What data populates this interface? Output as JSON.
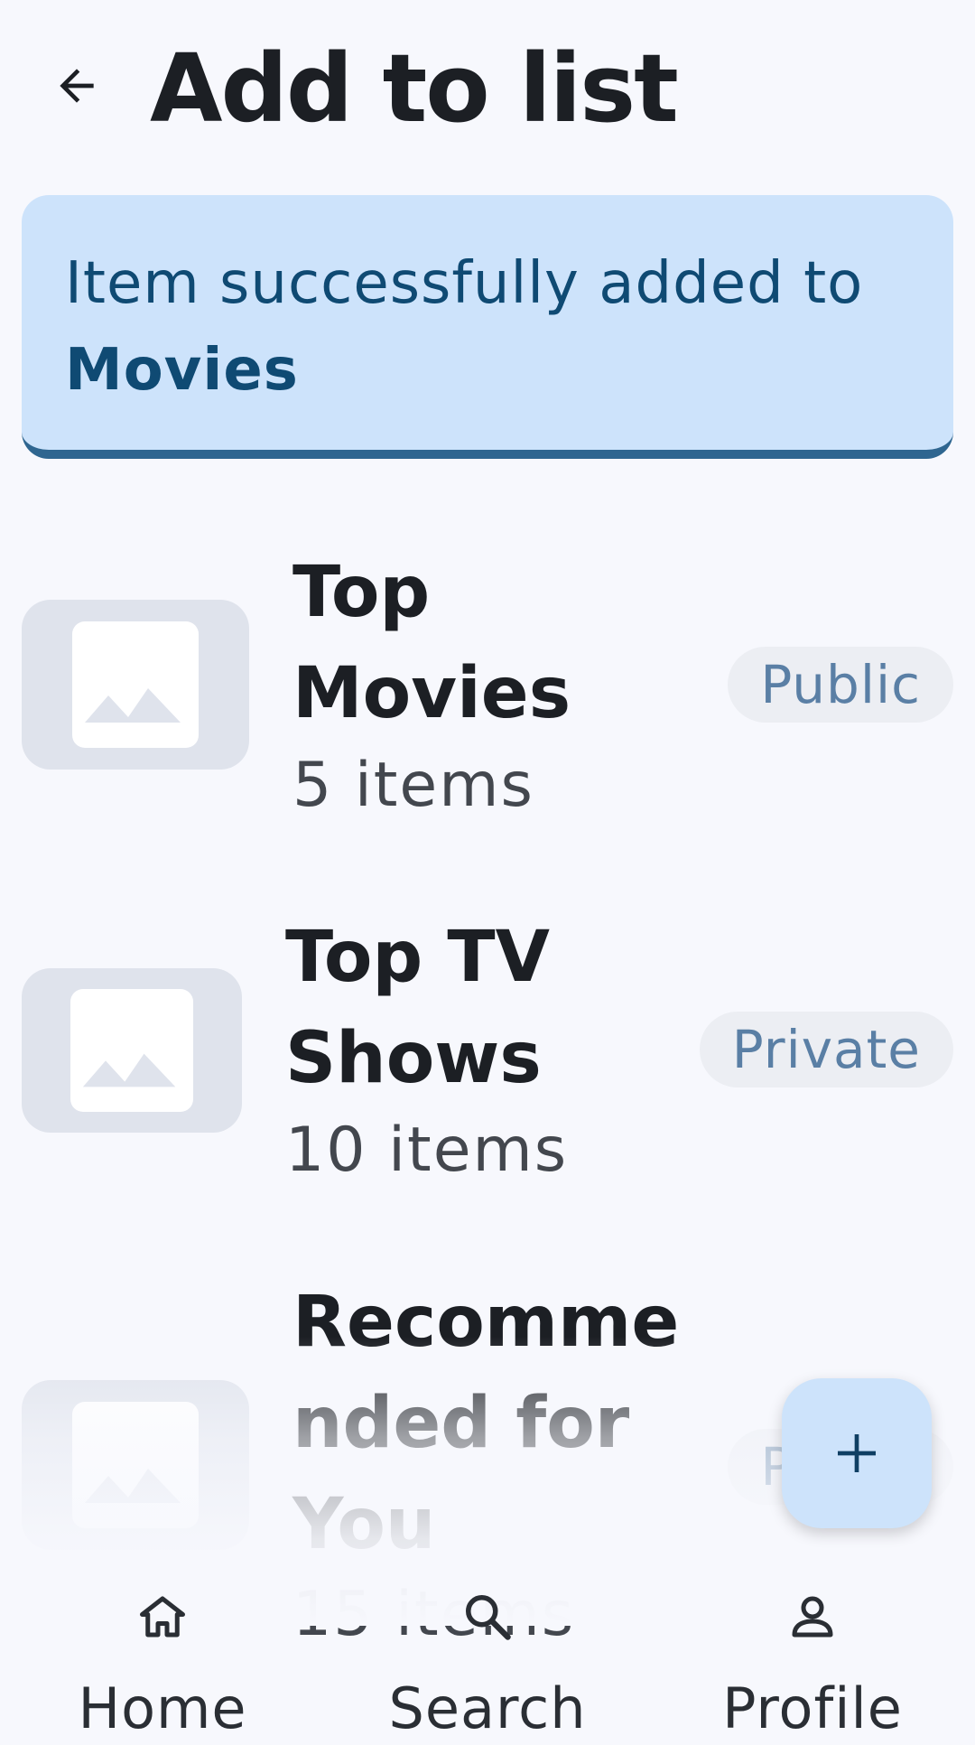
{
  "header": {
    "title": "Add to list",
    "back_icon": "arrow-left-icon"
  },
  "toast": {
    "text_prefix": "Item successfully added to ",
    "list_name": "Movies",
    "background": "#cde3fb",
    "accent": "#2f6690"
  },
  "lists": [
    {
      "name": "Top Movies",
      "count": "5 items",
      "visibility": "Public",
      "thumbnail_icon": "image-placeholder-icon"
    },
    {
      "name": "Top TV Shows",
      "count": "10 items",
      "visibility": "Private",
      "thumbnail_icon": "image-placeholder-icon"
    },
    {
      "name": "Recommended for You",
      "count": "15 items",
      "visibility": "Public",
      "thumbnail_icon": "image-placeholder-icon"
    }
  ],
  "fab": {
    "icon": "plus-icon"
  },
  "bottom_nav": [
    {
      "label": "Home",
      "icon": "home-icon"
    },
    {
      "label": "Search",
      "icon": "search-icon"
    },
    {
      "label": "Profile",
      "icon": "person-icon"
    }
  ]
}
